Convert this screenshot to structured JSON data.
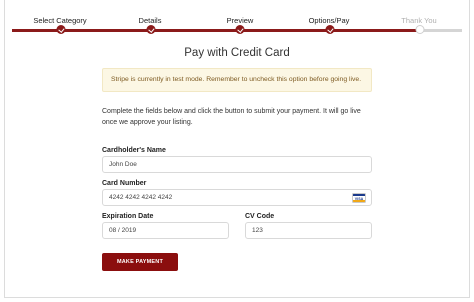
{
  "steps": [
    {
      "label": "Select Category",
      "state": "complete"
    },
    {
      "label": "Details",
      "state": "complete"
    },
    {
      "label": "Preview",
      "state": "complete"
    },
    {
      "label": "Options/Pay",
      "state": "complete"
    },
    {
      "label": "Thank You",
      "state": "pending"
    }
  ],
  "colors": {
    "accent": "#8b1a1a",
    "button": "#8b0e0e",
    "notice_bg": "#fcf7e4",
    "notice_text": "#7d5a21"
  },
  "page_title": "Pay with Credit Card",
  "notice": "Stripe is currently in test mode. Remember to uncheck this option before going live.",
  "intro": "Complete the fields below and click the button to submit your payment. It will go live once we approve your listing.",
  "form": {
    "cardholder_label": "Cardholder's Name",
    "cardholder_value": "John Doe",
    "card_number_label": "Card Number",
    "card_number_value": "4242 4242 4242 4242",
    "card_brand": "VISA",
    "expiration_label": "Expiration Date",
    "expiration_value": "08 / 2019",
    "cvc_label": "CV Code",
    "cvc_value": "123",
    "submit_label": "MAKE PAYMENT"
  }
}
